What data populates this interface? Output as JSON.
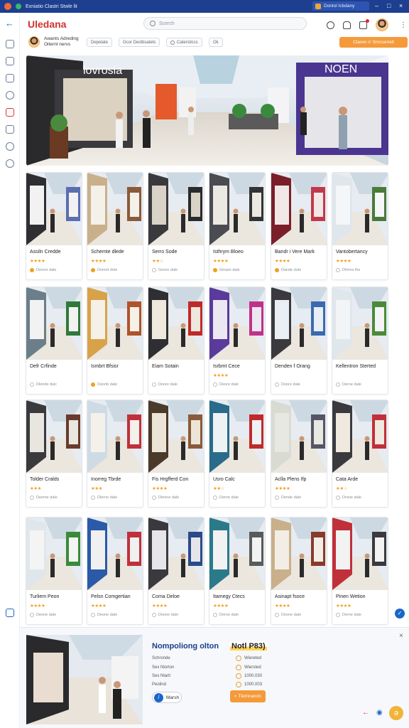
{
  "window": {
    "title": "Exniatio Clastri Stwle lit",
    "tray_label": "Dontol Icbdany"
  },
  "app": {
    "logo": "Uledana",
    "search_placeholder": "Scerch"
  },
  "filters": {
    "user_name": "Awants Adreding Oiternt nervs",
    "chips": [
      "Depelate",
      "Gcor Destbsatets",
      "Catersticcs",
      "Ok"
    ],
    "cta": "Claren n' Smcsenell"
  },
  "cards": [
    {
      "name": "Assiln Credde",
      "stars": "★★★★",
      "meta": "Deomr dale",
      "on": true
    },
    {
      "name": "Schemte dlede",
      "stars": "★★★★",
      "meta": "Domnt dole",
      "on": true
    },
    {
      "name": "Serro Sode",
      "stars": "★★☆",
      "meta": "Geore dale",
      "on": false
    },
    {
      "name": "Isthrym Bloeo",
      "stars": "★★★★",
      "meta": "Gmare dale",
      "on": true
    },
    {
      "name": "Bandr i Vere Mark",
      "stars": "★★★★",
      "meta": "Dande dule",
      "on": true
    },
    {
      "name": "Vantobertancy",
      "stars": "★★★★",
      "meta": "Dhrmo lhe",
      "on": false
    },
    {
      "name": "Defr Crfinde",
      "stars": "",
      "meta": "Dlende dulc",
      "on": false
    },
    {
      "name": "Ismbrt Bfsisr",
      "stars": "",
      "meta": "Deonb dale",
      "on": true
    },
    {
      "name": "Eiam Sotain",
      "stars": "",
      "meta": "Doore dale",
      "on": false
    },
    {
      "name": "Isrbmt Cece",
      "stars": "★★★★",
      "meta": "Deore dale",
      "on": false
    },
    {
      "name": "Denden f Orang",
      "stars": "",
      "meta": "Doore dale",
      "on": false
    },
    {
      "name": "Kellentron Sterted",
      "stars": "",
      "meta": "Derne dale",
      "on": false
    },
    {
      "name": "Tolder Cralds",
      "stars": "★★★",
      "meta": "Deeme dale",
      "on": false
    },
    {
      "name": "Inorreg Tbrde",
      "stars": "★★★",
      "meta": "Dlerne dale",
      "on": false
    },
    {
      "name": "Fis Hrgfferd Con",
      "stars": "★★★★",
      "meta": "Dlenne dale",
      "on": false
    },
    {
      "name": "Usro Calc",
      "stars": "★★☆",
      "meta": "Derne dale",
      "on": false
    },
    {
      "name": "Aclla Plens Ifp",
      "stars": "★★★★",
      "meta": "Dende dale",
      "on": false
    },
    {
      "name": "Cata Arde",
      "stars": "★★☆",
      "meta": "Drane dale",
      "on": false
    },
    {
      "name": "Turliem Peon",
      "stars": "★★★★",
      "meta": "Deone dale",
      "on": false
    },
    {
      "name": "Pelsn Comgertian",
      "stars": "★★★★",
      "meta": "Deone dale",
      "on": false
    },
    {
      "name": "Coma Deloe",
      "stars": "★★★★",
      "meta": "Deone dale",
      "on": false
    },
    {
      "name": "Itamegy Ctecs",
      "stars": "★★★★",
      "meta": "Derne dale",
      "on": false
    },
    {
      "name": "Asinapt fsoce",
      "stars": "★★★★",
      "meta": "Doone dale",
      "on": false
    },
    {
      "name": "Pinen Wetion",
      "stars": "★★★★",
      "meta": "Derne dale",
      "on": false
    }
  ],
  "detail": {
    "title": "Nompoliong olton",
    "price": "Notl P83)",
    "rows": [
      {
        "label": "Schronde",
        "value": "Wiereted"
      },
      {
        "label": "Sex Nlorton",
        "value": "Wiersted"
      },
      {
        "label": "Sex Nlarti",
        "value": "1000.030"
      },
      {
        "label": "Peolind",
        "value": "1000.003"
      }
    ],
    "map_button": "Marsh",
    "action_button": "Tlemnarcin"
  },
  "colors": {
    "accent": "#1b66c9",
    "brand": "#1e3f8f",
    "cta": "#f49a3a",
    "star": "#f0a020"
  }
}
